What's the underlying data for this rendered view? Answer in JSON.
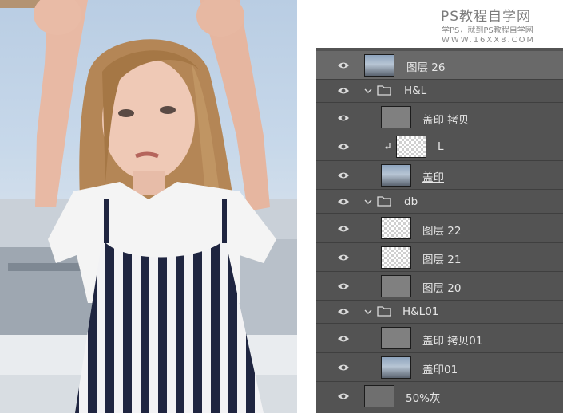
{
  "watermark": {
    "title": "PS教程自学网",
    "subtitle": "学PS，就到PS教程自学网",
    "url": "WWW.16XX8.COM"
  },
  "photo": {
    "description_icon": "portrait-photo"
  },
  "layers_panel": {
    "layers": [
      {
        "name": "图层 26",
        "kind": "photo",
        "indent": 0,
        "selected": true
      },
      {
        "name": "H&L",
        "kind": "group",
        "indent": 0,
        "expanded": true
      },
      {
        "name": "盖印 拷贝",
        "kind": "gray",
        "indent": 1
      },
      {
        "name": "L",
        "kind": "transparent",
        "indent": 1,
        "clipped": true
      },
      {
        "name": "盖印",
        "kind": "photo",
        "indent": 1,
        "underline": true
      },
      {
        "name": "db",
        "kind": "group",
        "indent": 0,
        "expanded": true
      },
      {
        "name": "图层 22",
        "kind": "transparent",
        "indent": 1
      },
      {
        "name": "图层 21",
        "kind": "transparent",
        "indent": 1
      },
      {
        "name": "图层 20",
        "kind": "gray",
        "indent": 1
      },
      {
        "name": "H&L01",
        "kind": "group",
        "indent": 0,
        "expanded": true
      },
      {
        "name": "盖印 拷贝01",
        "kind": "gray",
        "indent": 1
      },
      {
        "name": "盖印01",
        "kind": "photo",
        "indent": 1
      },
      {
        "name": "50%灰",
        "kind": "gray50",
        "indent": 0
      }
    ]
  },
  "colors": {
    "panel_bg": "#535353",
    "selected_row": "#696969",
    "text": "#e6e6e6"
  }
}
